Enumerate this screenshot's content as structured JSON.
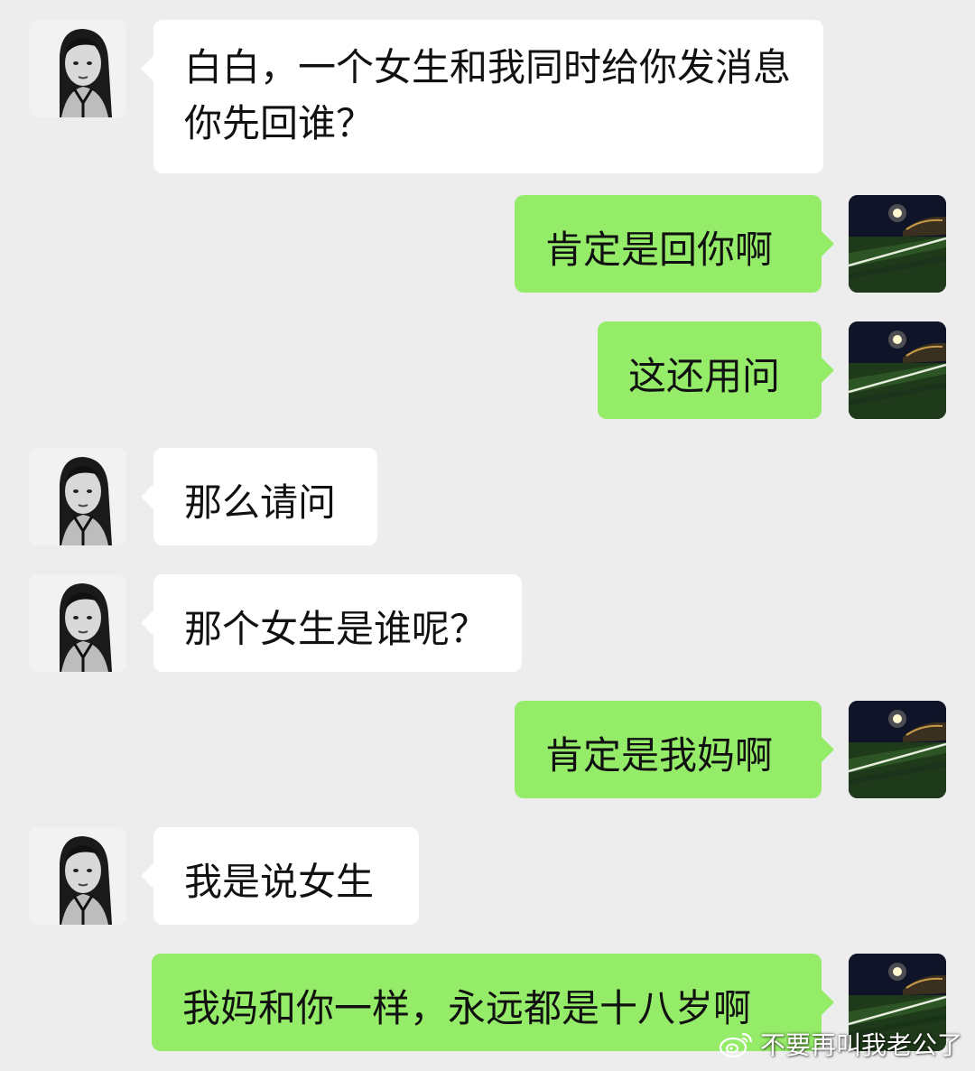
{
  "messages": [
    {
      "side": "in",
      "text": "白白，一个女生和我同时给你发消息你先回谁？"
    },
    {
      "side": "out",
      "text": "肯定是回你啊"
    },
    {
      "side": "out",
      "text": "这还用问"
    },
    {
      "side": "in",
      "text": "那么请问"
    },
    {
      "side": "in",
      "text": "那个女生是谁呢？"
    },
    {
      "side": "out",
      "text": "肯定是我妈啊"
    },
    {
      "side": "in",
      "text": "我是说女生"
    },
    {
      "side": "out",
      "text": "我妈和你一样，永远都是十八岁啊"
    }
  ],
  "watermark": {
    "icon": "weibo-logo-icon",
    "text": "不要再叫我老公了"
  },
  "colors": {
    "background": "#ededed",
    "incoming_bubble": "#ffffff",
    "outgoing_bubble": "#95ec69"
  }
}
